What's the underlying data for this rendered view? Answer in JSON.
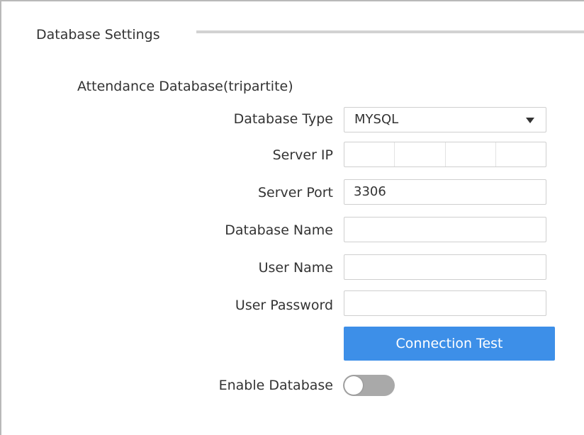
{
  "section": {
    "title": "Database Settings"
  },
  "subsection": {
    "title": "Attendance Database(tripartite)"
  },
  "form": {
    "database_type": {
      "label": "Database Type",
      "value": "MYSQL"
    },
    "server_ip": {
      "label": "Server IP",
      "segments": [
        "",
        "",
        "",
        ""
      ]
    },
    "server_port": {
      "label": "Server Port",
      "value": "3306"
    },
    "database_name": {
      "label": "Database Name",
      "value": ""
    },
    "user_name": {
      "label": "User Name",
      "value": ""
    },
    "user_password": {
      "label": "User Password",
      "value": ""
    },
    "connection_test": {
      "label": "Connection Test"
    },
    "enable_database": {
      "label": "Enable Database",
      "enabled": false
    }
  },
  "colors": {
    "accent": "#3d8fe8",
    "toggle_off": "#a9a9a9"
  },
  "icons": {
    "dropdown": "caret-down-icon"
  }
}
